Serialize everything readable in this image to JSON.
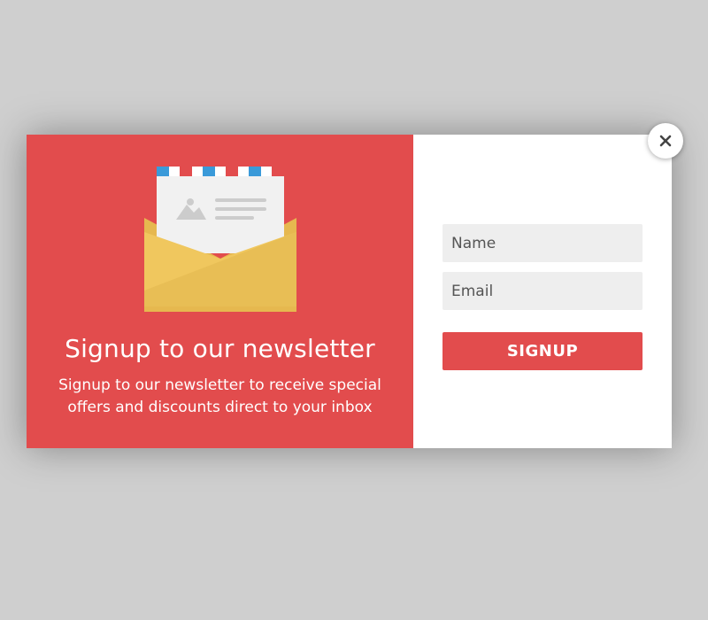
{
  "colors": {
    "accent": "#e24c4d",
    "backdrop": "#cfcfcf",
    "field_bg": "#eeeeee",
    "envelope": "#f0c75e"
  },
  "left_panel": {
    "illustration_icon": "open-envelope-icon",
    "headline": "Signup to our newsletter",
    "subtext_line1": "Signup to our newsletter to receive special",
    "subtext_line2": "offers and discounts direct to your inbox"
  },
  "form": {
    "name_placeholder": "Name",
    "email_placeholder": "Email",
    "signup_label": "SIGNUP"
  },
  "close_button": {
    "icon": "close-icon"
  }
}
